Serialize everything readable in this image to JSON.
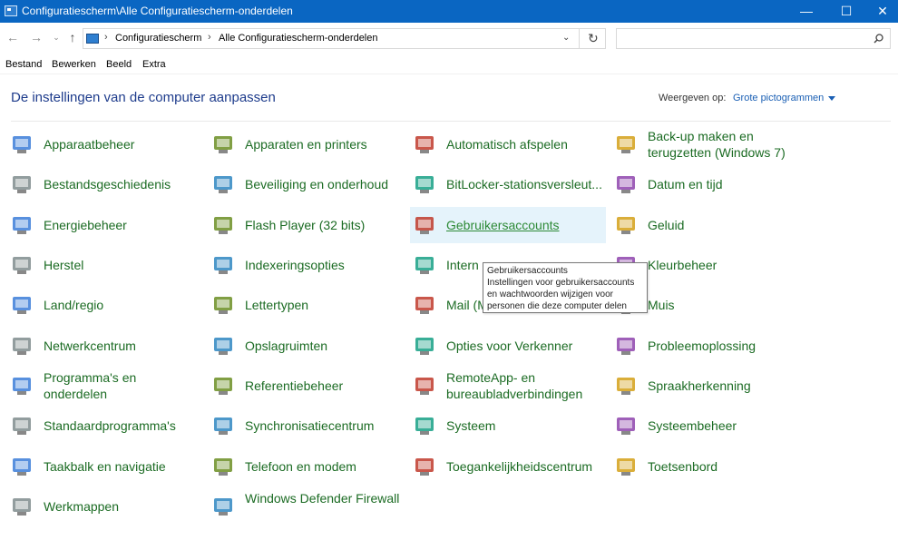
{
  "window": {
    "title": "Configuratiescherm\\Alle Configuratiescherm-onderdelen"
  },
  "address": {
    "crumbs": [
      "Configuratiescherm",
      "Alle Configuratiescherm-onderdelen"
    ],
    "search_placeholder": ""
  },
  "menu": [
    "Bestand",
    "Bewerken",
    "Beeld",
    "Extra"
  ],
  "header": {
    "title": "De instellingen van de computer aanpassen",
    "view_label": "Weergeven op:",
    "view_value": "Grote pictogrammen"
  },
  "items": [
    {
      "label": "Apparaatbeheer",
      "icon": "device-manager-icon"
    },
    {
      "label": "Apparaten en printers",
      "icon": "printer-icon"
    },
    {
      "label": "Automatisch afspelen",
      "icon": "autoplay-icon"
    },
    {
      "label": "Back-up maken en terugzetten (Windows 7)",
      "icon": "backup-icon"
    },
    {
      "label": "Bestandsgeschiedenis",
      "icon": "file-history-icon"
    },
    {
      "label": "Beveiliging en onderhoud",
      "icon": "flag-icon"
    },
    {
      "label": "BitLocker-stationsversleut...",
      "icon": "bitlocker-icon"
    },
    {
      "label": "Datum en tijd",
      "icon": "clock-icon"
    },
    {
      "label": "Energiebeheer",
      "icon": "power-icon"
    },
    {
      "label": "Flash Player (32 bits)",
      "icon": "flash-icon"
    },
    {
      "label": "Gebruikersaccounts",
      "icon": "users-icon"
    },
    {
      "label": "Geluid",
      "icon": "speaker-icon"
    },
    {
      "label": "Herstel",
      "icon": "recovery-icon"
    },
    {
      "label": "Indexeringsopties",
      "icon": "indexing-icon"
    },
    {
      "label": "Intern",
      "icon": "internet-options-icon"
    },
    {
      "label": "Kleurbeheer",
      "icon": "color-icon"
    },
    {
      "label": "Land/regio",
      "icon": "globe-icon"
    },
    {
      "label": "Lettertypen",
      "icon": "font-icon"
    },
    {
      "label": "Mail (Microsoft Outlook)",
      "icon": "mail-icon"
    },
    {
      "label": "Muis",
      "icon": "mouse-icon"
    },
    {
      "label": "Netwerkcentrum",
      "icon": "network-icon"
    },
    {
      "label": "Opslagruimten",
      "icon": "storage-icon"
    },
    {
      "label": "Opties voor Verkenner",
      "icon": "folder-options-icon"
    },
    {
      "label": "Probleemoplossing",
      "icon": "troubleshoot-icon"
    },
    {
      "label": "Programma's en onderdelen",
      "icon": "programs-icon"
    },
    {
      "label": "Referentiebeheer",
      "icon": "credential-icon"
    },
    {
      "label": "RemoteApp- en bureaubladverbindingen",
      "icon": "remoteapp-icon"
    },
    {
      "label": "Spraakherkenning",
      "icon": "microphone-icon"
    },
    {
      "label": "Standaardprogramma's",
      "icon": "default-programs-icon"
    },
    {
      "label": "Synchronisatiecentrum",
      "icon": "sync-icon"
    },
    {
      "label": "Systeem",
      "icon": "system-icon"
    },
    {
      "label": "Systeembeheer",
      "icon": "admin-tools-icon"
    },
    {
      "label": "Taakbalk en navigatie",
      "icon": "taskbar-icon"
    },
    {
      "label": "Telefoon en modem",
      "icon": "phone-icon"
    },
    {
      "label": "Toegankelijkheidscentrum",
      "icon": "accessibility-icon"
    },
    {
      "label": "Toetsenbord",
      "icon": "keyboard-icon"
    },
    {
      "label": "Werkmappen",
      "icon": "work-folders-icon"
    },
    {
      "label": "Windows Defender Firewall",
      "icon": "firewall-icon"
    }
  ],
  "tooltip": {
    "title": "Gebruikersaccounts",
    "text": "Instellingen voor gebruikersaccounts en wachtwoorden wijzigen voor personen die deze computer delen"
  },
  "colors": {
    "link_green": "#1b6b23",
    "titlebar_blue": "#0a66c2",
    "hover_bg": "#e5f3fb"
  }
}
